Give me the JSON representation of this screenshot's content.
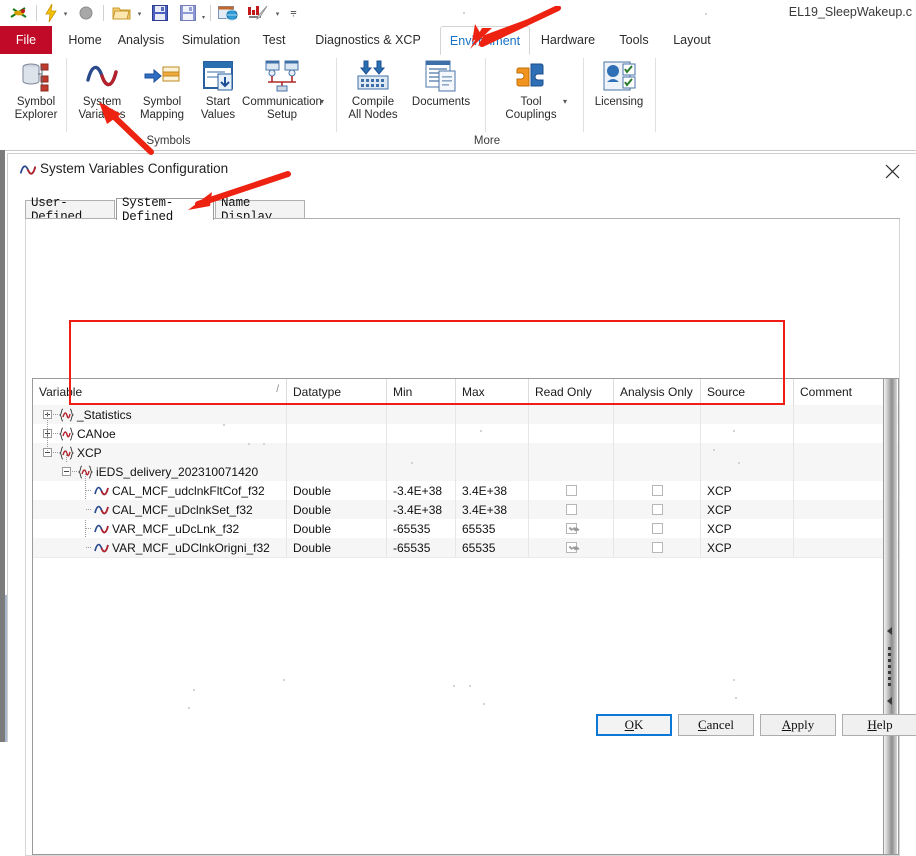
{
  "app": {
    "title": "EL19_SleepWakeup.c",
    "quick_access": [
      {
        "name": "canoe-logo-icon",
        "glyph": "canoe"
      },
      {
        "name": "start-measurement-icon",
        "glyph": "bolt"
      },
      {
        "name": "stop-measurement-icon",
        "glyph": "circle"
      },
      {
        "name": "open-configuration-icon",
        "glyph": "folder"
      },
      {
        "name": "save-configuration-icon",
        "glyph": "save"
      },
      {
        "name": "save-as-icon",
        "glyph": "saveas"
      },
      {
        "name": "online-icon",
        "glyph": "globe"
      },
      {
        "name": "signal-generator-icon",
        "glyph": "pen"
      },
      {
        "name": "customize-quick-access-icon",
        "glyph": "caret"
      }
    ],
    "ribbon_tabs": [
      {
        "label": "File",
        "active": false,
        "file": true
      },
      {
        "label": "Home",
        "active": false
      },
      {
        "label": "Analysis",
        "active": false
      },
      {
        "label": "Simulation",
        "active": false
      },
      {
        "label": "Test",
        "active": false
      },
      {
        "label": "Diagnostics & XCP",
        "active": false
      },
      {
        "label": "Environment",
        "active": true
      },
      {
        "label": "Hardware",
        "active": false
      },
      {
        "label": "Tools",
        "active": false
      },
      {
        "label": "Layout",
        "active": false
      }
    ],
    "ribbon_groups": [
      {
        "name": "symbols",
        "label": "Symbols",
        "buttons": [
          {
            "label": "Symbol\nExplorer",
            "icon": "symbol-explorer-icon",
            "dropdown": false
          },
          {
            "label": "System\nVariables",
            "icon": "system-variables-icon",
            "dropdown": false
          },
          {
            "label": "Symbol\nMapping",
            "icon": "symbol-mapping-icon",
            "dropdown": false
          },
          {
            "label": "Start\nValues",
            "icon": "start-values-icon",
            "dropdown": false
          },
          {
            "label": "Communication\nSetup",
            "icon": "communication-setup-icon",
            "dropdown": true
          }
        ]
      },
      {
        "name": "more",
        "label": "More",
        "buttons": [
          {
            "label": "Compile\nAll Nodes",
            "icon": "compile-all-nodes-icon",
            "dropdown": false
          },
          {
            "label": "Documents",
            "icon": "documents-icon",
            "dropdown": false
          },
          {
            "label": "Tool\nCouplings",
            "icon": "tool-couplings-icon",
            "dropdown": true
          },
          {
            "label": "Licensing",
            "icon": "licensing-icon",
            "dropdown": false
          }
        ]
      }
    ]
  },
  "dialog": {
    "title": "System Variables Configuration",
    "icon": "system-variables-icon",
    "close_label": "✕",
    "tabs": [
      {
        "label": "User-Defined",
        "active": false
      },
      {
        "label": "System-Defined",
        "active": true
      },
      {
        "label": "Name Display",
        "active": false
      }
    ],
    "table": {
      "columns": [
        {
          "key": "variable",
          "label": "Variable",
          "sort": "/"
        },
        {
          "key": "datatype",
          "label": "Datatype"
        },
        {
          "key": "min",
          "label": "Min"
        },
        {
          "key": "max",
          "label": "Max"
        },
        {
          "key": "read_only",
          "label": "Read Only"
        },
        {
          "key": "analysis_only",
          "label": "Analysis Only"
        },
        {
          "key": "source",
          "label": "Source"
        },
        {
          "key": "comment",
          "label": "Comment"
        }
      ],
      "rows": [
        {
          "kind": "group",
          "depth": 0,
          "expanded": false,
          "variable": "_Statistics",
          "datatype": "",
          "min": "",
          "max": "",
          "read_only": null,
          "analysis_only": null,
          "source": "",
          "comment": ""
        },
        {
          "kind": "group",
          "depth": 0,
          "expanded": false,
          "variable": "CANoe",
          "datatype": "",
          "min": "",
          "max": "",
          "read_only": null,
          "analysis_only": null,
          "source": "",
          "comment": ""
        },
        {
          "kind": "group",
          "depth": 0,
          "expanded": true,
          "variable": "XCP",
          "datatype": "",
          "min": "",
          "max": "",
          "read_only": null,
          "analysis_only": null,
          "source": "",
          "comment": ""
        },
        {
          "kind": "group",
          "depth": 1,
          "expanded": true,
          "variable": "iEDS_delivery_202310071420",
          "datatype": "",
          "min": "",
          "max": "",
          "read_only": null,
          "analysis_only": null,
          "source": "",
          "comment": ""
        },
        {
          "kind": "variable",
          "depth": 2,
          "expanded": null,
          "variable": "CAL_MCF_udclnkFltCof_f32",
          "datatype": "Double",
          "min": "-3.4E+38",
          "max": "3.4E+38",
          "read_only": false,
          "analysis_only": false,
          "source": "XCP",
          "comment": ""
        },
        {
          "kind": "variable",
          "depth": 2,
          "expanded": null,
          "variable": "CAL_MCF_uDclnkSet_f32",
          "datatype": "Double",
          "min": "-3.4E+38",
          "max": "3.4E+38",
          "read_only": false,
          "analysis_only": false,
          "source": "XCP",
          "comment": ""
        },
        {
          "kind": "variable",
          "depth": 2,
          "expanded": null,
          "variable": "VAR_MCF_uDcLnk_f32",
          "datatype": "Double",
          "min": "-65535",
          "max": "65535",
          "read_only": true,
          "analysis_only": false,
          "source": "XCP",
          "comment": ""
        },
        {
          "kind": "variable",
          "depth": 2,
          "expanded": null,
          "variable": "VAR_MCF_uDClnkOrigni_f32",
          "datatype": "Double",
          "min": "-65535",
          "max": "65535",
          "read_only": true,
          "analysis_only": false,
          "source": "XCP",
          "comment": ""
        }
      ]
    },
    "buttons": [
      {
        "name": "ok-button",
        "label": "OK",
        "accel": "O",
        "default": true
      },
      {
        "name": "cancel-button",
        "label": "Cancel",
        "accel": "C",
        "default": false
      },
      {
        "name": "apply-button",
        "label": "Apply",
        "accel": "A",
        "default": false
      },
      {
        "name": "help-button",
        "label": "Help",
        "accel": "H",
        "default": false
      }
    ]
  },
  "annotations": {
    "accent_color": "#ef1d14",
    "arrows": [
      {
        "name": "arrow-to-environment-tab",
        "target": "Environment"
      },
      {
        "name": "arrow-to-system-variables-button",
        "target": "System Variables"
      },
      {
        "name": "arrow-to-system-defined-tab",
        "target": "System-Defined"
      }
    ],
    "highlight_box": {
      "name": "xcp-variables-highlight",
      "rows": 4
    }
  }
}
